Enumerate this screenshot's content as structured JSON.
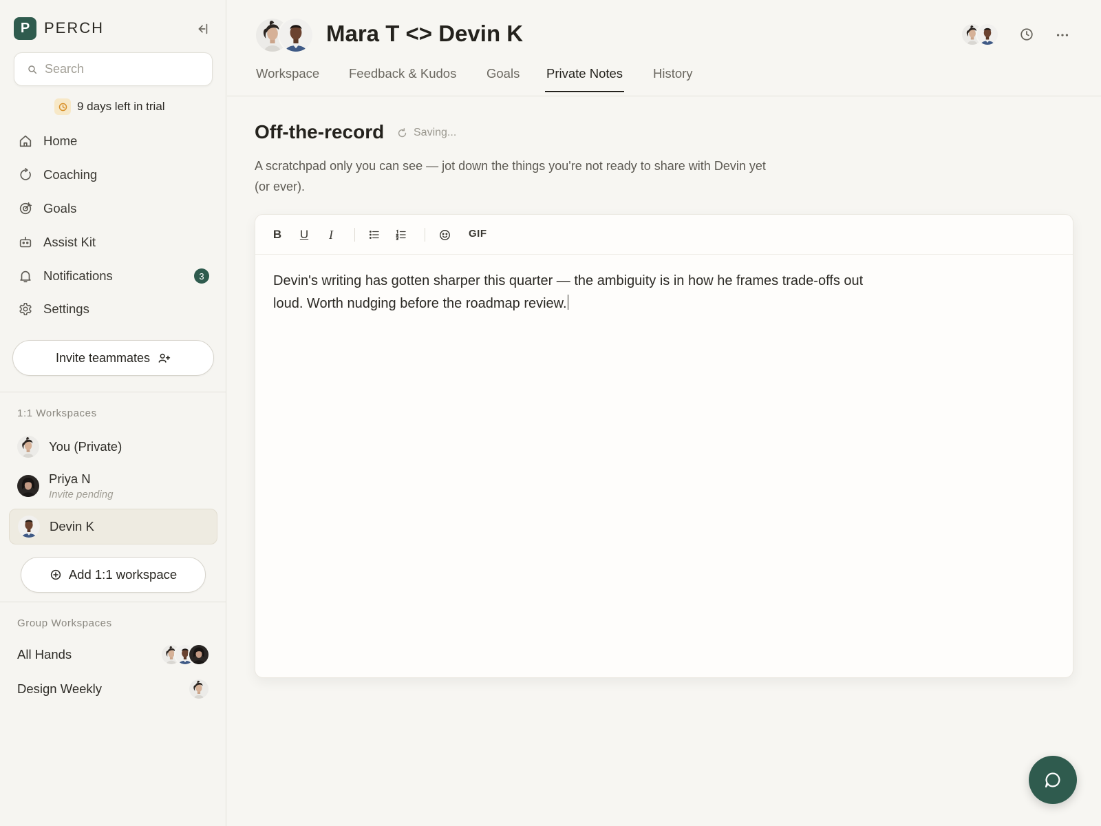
{
  "brand": {
    "name": "PERCH",
    "logo_letter": "P",
    "color": "#2f5b4e"
  },
  "search": {
    "placeholder": "Search",
    "value": ""
  },
  "trial": {
    "text": "9 days left in trial",
    "icon": "clock-icon"
  },
  "nav": {
    "items": [
      {
        "label": "Home",
        "icon": "home-icon"
      },
      {
        "label": "Coaching",
        "icon": "refresh-icon"
      },
      {
        "label": "Goals",
        "icon": "target-icon"
      },
      {
        "label": "Assist Kit",
        "icon": "robot-icon"
      },
      {
        "label": "Notifications",
        "icon": "bell-icon",
        "badge": "3"
      },
      {
        "label": "Settings",
        "icon": "gear-icon"
      }
    ]
  },
  "invite": {
    "label": "Invite teammates",
    "icon": "user-plus-icon"
  },
  "one_on_one": {
    "label": "1:1 Workspaces",
    "items": [
      {
        "name": "You (Private)"
      },
      {
        "name": "Priya N",
        "sub": "Invite pending"
      },
      {
        "name": "Devin K",
        "active": true
      }
    ],
    "add_label": "Add 1:1 workspace"
  },
  "groups": {
    "label": "Group Workspaces",
    "items": [
      {
        "name": "All Hands"
      },
      {
        "name": "Design Weekly"
      }
    ]
  },
  "header": {
    "title": "Mara T <> Devin K",
    "tabs": [
      {
        "label": "Workspace"
      },
      {
        "label": "Feedback & Kudos"
      },
      {
        "label": "Goals"
      },
      {
        "label": "Private Notes",
        "active": true
      },
      {
        "label": "History"
      }
    ]
  },
  "notes": {
    "title": "Off-the-record",
    "status": "Saving...",
    "description": "A scratchpad only you can see — jot down the things you're not ready to share with Devin yet (or ever).",
    "body": "Devin's writing has gotten sharper this quarter — the ambiguity is in how he frames trade-offs out loud. Worth nudging before the roadmap review."
  },
  "toolbar": {
    "bold": "B",
    "underline": "U",
    "italic": "I",
    "gif": "GIF"
  }
}
